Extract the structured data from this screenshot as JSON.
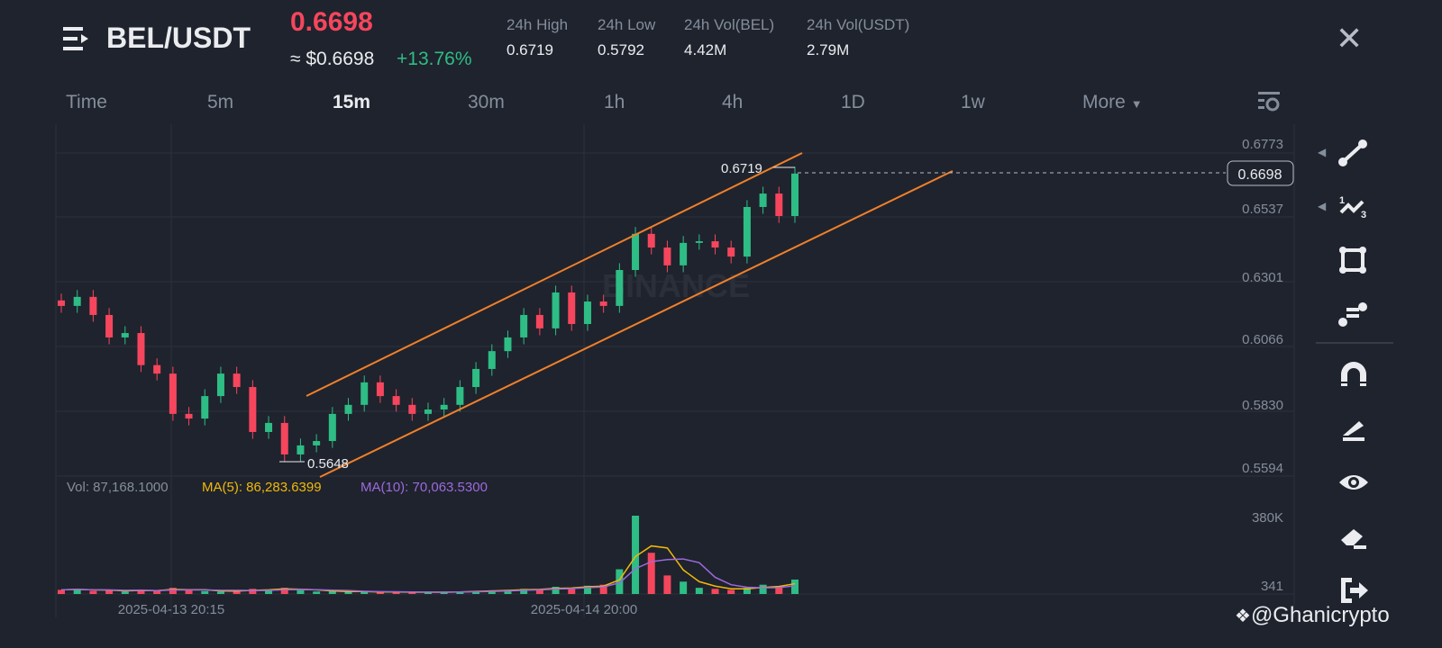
{
  "header": {
    "pair": "BEL/USDT",
    "price": "0.6698",
    "usd_price": "≈ $0.6698",
    "change": "+13.76%",
    "stats": [
      {
        "label": "24h High",
        "value": "0.6719"
      },
      {
        "label": "24h Low",
        "value": "0.5792"
      },
      {
        "label": "24h Vol(BEL)",
        "value": "4.42M"
      },
      {
        "label": "24h Vol(USDT)",
        "value": "2.79M"
      }
    ]
  },
  "intervals": [
    "Time",
    "5m",
    "15m",
    "30m",
    "1h",
    "4h",
    "1D",
    "1w",
    "More"
  ],
  "active_interval": "15m",
  "chart": {
    "price_labels": [
      "0.6773",
      "0.6537",
      "0.6301",
      "0.6066",
      "0.5830",
      "0.5594"
    ],
    "current_price": "0.6698",
    "high_marker": "0.6719",
    "low_marker": "0.5648",
    "vol_labels": [
      "380K",
      "341"
    ],
    "time_labels": [
      "2025-04-13 20:15",
      "2025-04-14 20:00"
    ],
    "watermark": "BINANCE"
  },
  "indicators": {
    "vol": "Vol: 87,168.1000",
    "ma5": "MA(5): 86,283.6399",
    "ma10": "MA(10): 70,063.5300"
  },
  "colors": {
    "up": "#2ebd85",
    "down": "#f6465d",
    "channel": "#f0802a",
    "ma5": "#f0b90b",
    "ma10": "#9c6ade"
  },
  "chart_data": {
    "type": "candlestick",
    "ylim": [
      0.5594,
      0.6773
    ],
    "closes": [
      0.6215,
      0.6248,
      0.6182,
      0.61,
      0.6116,
      0.5999,
      0.5968,
      0.5821,
      0.5804,
      0.5886,
      0.5968,
      0.5919,
      0.5755,
      0.5788,
      0.5673,
      0.5706,
      0.5722,
      0.5821,
      0.5854,
      0.5936,
      0.5886,
      0.5854,
      0.5821,
      0.5837,
      0.5854,
      0.5919,
      0.5985,
      0.605,
      0.61,
      0.6182,
      0.6133,
      0.6264,
      0.6149,
      0.6231,
      0.6215,
      0.6346,
      0.6478,
      0.6428,
      0.6363,
      0.6445,
      0.6451,
      0.6428,
      0.6395,
      0.6576,
      0.6625,
      0.6543,
      0.6698
    ],
    "volumes": [
      20,
      25,
      15,
      18,
      12,
      22,
      15,
      30,
      18,
      14,
      12,
      16,
      25,
      20,
      30,
      18,
      12,
      14,
      10,
      12,
      8,
      10,
      9,
      8,
      10,
      12,
      15,
      18,
      20,
      25,
      22,
      35,
      30,
      40,
      45,
      120,
      380,
      200,
      90,
      60,
      30,
      25,
      20,
      30,
      45,
      35,
      70
    ]
  },
  "watermark_user": "@Ghanicrypto"
}
